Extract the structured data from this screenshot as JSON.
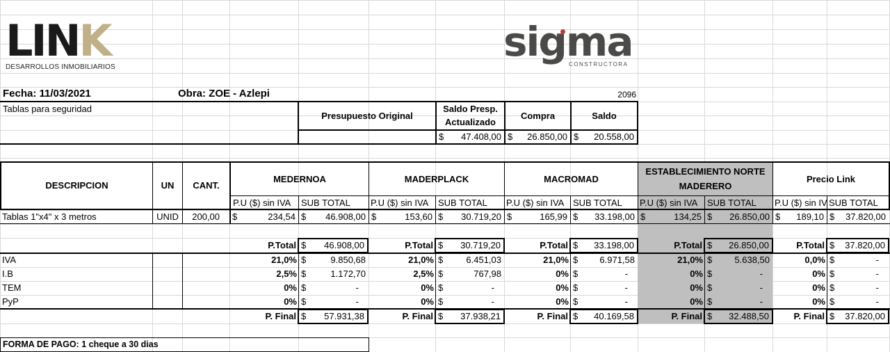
{
  "logos": {
    "link": {
      "mark_ascii": "LIN",
      "mark_k": "K",
      "subtitle": "DESARROLLOS INMOBILIARIOS"
    },
    "sigma": {
      "word": "sigma",
      "subtitle": "CONSTRUCTORA"
    }
  },
  "header": {
    "fecha": "Fecha: 11/03/2021",
    "obra": "Obra: ZOE - Azlepi",
    "number": "2096",
    "subject": "Tablas para seguridad"
  },
  "budget": {
    "col1": "Presupuesto Original",
    "col2_line1": "Saldo Presp.",
    "col2_line2": "Actualizado",
    "col3": "Compra",
    "col4": "Saldo",
    "cur": "$",
    "saldo_act": "47.408,00",
    "compra": "26.850,00",
    "saldo": "20.558,00"
  },
  "table": {
    "h_desc": "DESCRIPCION",
    "h_un": "UN",
    "h_cant": "CANT.",
    "pu_label": "P.U ($) sin IVA",
    "pu_label_short": "P.U ($) sin IV",
    "sub_label": "SUB TOTAL",
    "item_desc": "Tablas 1\"x4\" x 3 metros",
    "item_un": "UNID",
    "item_cant": "200,00",
    "labels": {
      "ptotal": "P.Total",
      "pfinal": "P. Final",
      "iva": "IVA",
      "ib": "I.B",
      "tem": "TEM",
      "pyp": "PyP"
    },
    "cur": "$",
    "dash": "-"
  },
  "vendors": [
    {
      "name": "MEDERNOA",
      "pu": "234,54",
      "sub": "46.908,00",
      "ptotal": "46.908,00",
      "iva_pct": "21,0%",
      "iva": "9.850,68",
      "ib_pct": "2,5%",
      "ib": "1.172,70",
      "tem_pct": "0%",
      "tem": "-",
      "pyp_pct": "0%",
      "pyp": "-",
      "pfinal": "57.931,38"
    },
    {
      "name": "MADERPLACK",
      "pu": "153,60",
      "sub": "30.719,20",
      "ptotal": "30.719,20",
      "iva_pct": "21,0%",
      "iva": "6.451,03",
      "ib_pct": "2,5%",
      "ib": "767,98",
      "tem_pct": "0%",
      "tem": "-",
      "pyp_pct": "0%",
      "pyp": "-",
      "pfinal": "37.938,21"
    },
    {
      "name": "MACROMAD",
      "pu": "165,99",
      "sub": "33.198,00",
      "ptotal": "33.198,00",
      "iva_pct": "21,0%",
      "iva": "6.971,58",
      "ib_pct": "0%",
      "ib": "-",
      "tem_pct": "0%",
      "tem": "-",
      "pyp_pct": "0%",
      "pyp": "-",
      "pfinal": "40.169,58"
    },
    {
      "name_line1": "ESTABLECIMIENTO NORTE",
      "name_line2": "MADERERO",
      "pu": "134,25",
      "sub": "26.850,00",
      "ptotal": "26.850,00",
      "iva_pct": "21,0%",
      "iva": "5.638,50",
      "ib_pct": "0%",
      "ib": "-",
      "tem_pct": "0%",
      "tem": "-",
      "pyp_pct": "0%",
      "pyp": "-",
      "pfinal": "32.488,50"
    },
    {
      "name": "Precio Link",
      "pu": "189,10",
      "sub": "37.820,00",
      "ptotal": "37.820,00",
      "iva_pct": "0,0%",
      "iva": "-",
      "ib_pct": "0%",
      "ib": "-",
      "tem_pct": "0%",
      "tem": "-",
      "pyp_pct": "0%",
      "pyp": "-",
      "pfinal": "37.820,00"
    }
  ],
  "footer": {
    "payment": "FORMA DE PAGO: 1 cheque a 30 dias"
  },
  "colors": {
    "gray": "#bfbfbf",
    "link_gold": "#bfb08a",
    "sigma_gray": "#4a4a48",
    "sigma_red": "#c0392b"
  }
}
